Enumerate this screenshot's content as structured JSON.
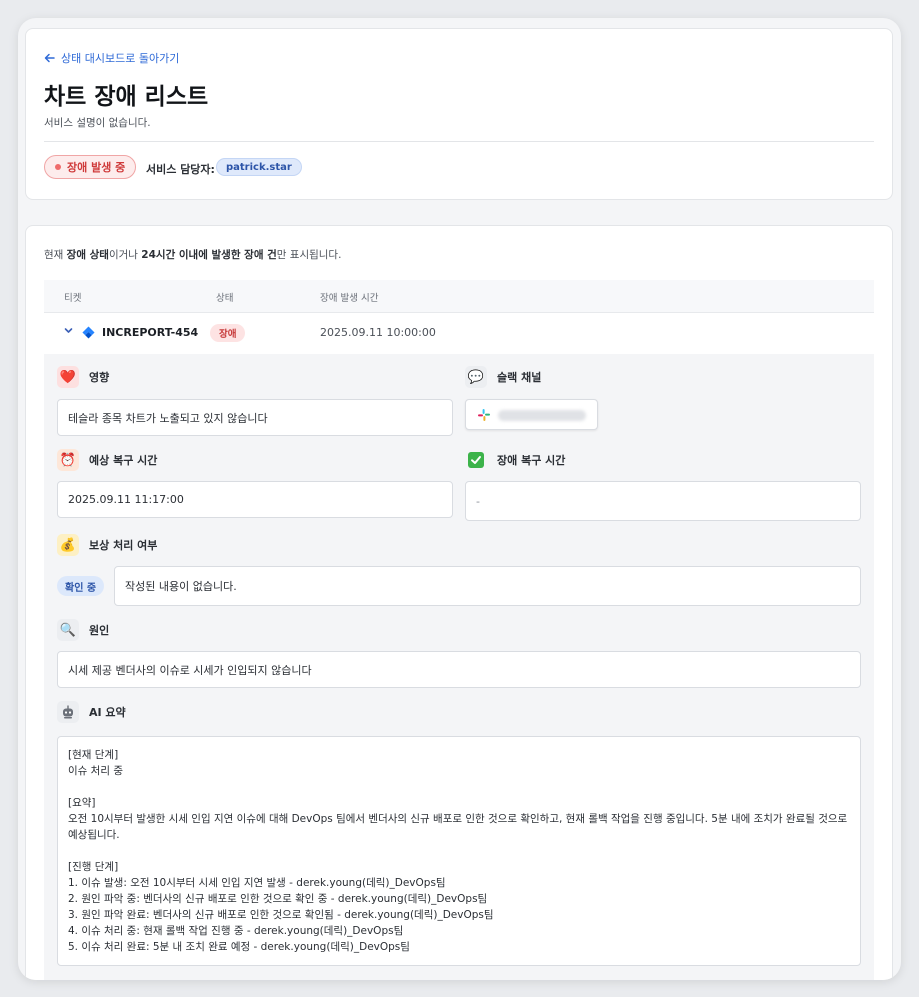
{
  "header": {
    "back_label": "상태 대시보드로 돌아가기",
    "title": "차트 장애 리스트",
    "description": "서비스 설명이 없습니다.",
    "status_label": "장애 발생 중",
    "owner_label": "서비스 담당자:",
    "owner_name": "patrick.star"
  },
  "notice": {
    "p1": "현재 ",
    "b1": "장애 상태",
    "p2": "이거나 ",
    "b2": "24시간 이내에 발생한 장애 건",
    "p3": "만 표시됩니다."
  },
  "table": {
    "columns": [
      "티켓",
      "상태",
      "장애 발생 시간"
    ],
    "row": {
      "ticket": "INCREPORT-454",
      "state": "장애",
      "time": "2025.09.11 10:00:00"
    }
  },
  "detail": {
    "impact_label": "영향",
    "impact_value": "테슬라 종목 차트가 노출되고 있지 않습니다",
    "slack_label": "슬랙 채널",
    "eta_label": "예상 복구 시간",
    "eta_value": "2025.09.11 11:17:00",
    "recovered_label": "장애 복구 시간",
    "recovered_value": "-",
    "compensation_label": "보상 처리 여부",
    "compensation_status": "확인 중",
    "compensation_value": "작성된 내용이 없습니다.",
    "cause_label": "원인",
    "cause_value": "시세 제공 벤더사의 이슈로 시세가 인입되지 않습니다",
    "ai_label": "AI 요약",
    "ai_summary": {
      "stage_title": "[현재 단계]",
      "stage_value": "이슈 처리 중",
      "summary_title": "[요약]",
      "summary_value": "오전 10시부터 발생한 시세 인입 지연 이슈에 대해 DevOps 팀에서 벤더사의 신규 배포로 인한 것으로 확인하고, 현재 롤백 작업을 진행 중입니다. 5분 내에 조치가 완료될 것으로 예상됩니다.",
      "progress_title": "[진행 단계]",
      "steps": [
        "1. 이슈 발생: 오전 10시부터 시세 인입 지연 발생 - derek.young(데릭)_DevOps팀",
        "2. 원인 파악 중: 벤더사의 신규 배포로 인한 것으로 확인 중 - derek.young(데릭)_DevOps팀",
        "3. 원인 파악 완료: 벤더사의 신규 배포로 인한 것으로 확인됨 - derek.young(데릭)_DevOps팀",
        "4. 이슈 처리 중: 현재 롤백 작업 진행 중 - derek.young(데릭)_DevOps팀",
        "5. 이슈 처리 완료: 5분 내 조치 완료 예정 - derek.young(데릭)_DevOps팀"
      ]
    }
  },
  "colors": {
    "accent": "#2f6ad7",
    "danger": "#cf3a3a",
    "danger_bg": "#fdecec"
  },
  "icons": {
    "back": "arrow-left-icon",
    "impact": "heart-icon",
    "slack_channel": "speech-bubble-icon",
    "eta": "alarm-clock-icon",
    "recovered": "check-mark-icon",
    "compensation": "money-bag-icon",
    "cause": "magnifier-icon",
    "ai": "robot-icon"
  }
}
